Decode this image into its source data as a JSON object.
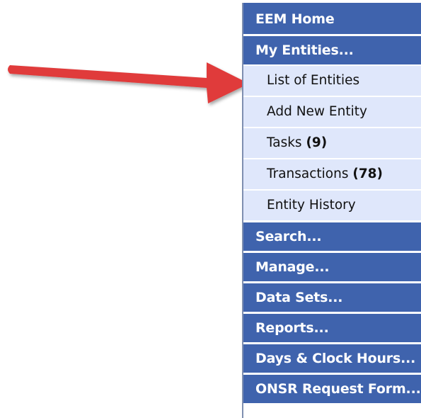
{
  "menu": {
    "items": [
      {
        "label": "EEM Home",
        "type": "header"
      },
      {
        "label": "My Entities...",
        "type": "header"
      },
      {
        "label": "List of Entities",
        "type": "sub"
      },
      {
        "label": "Add New Entity",
        "type": "sub"
      },
      {
        "label": "Tasks ",
        "count": "(9)",
        "type": "sub"
      },
      {
        "label": "Transactions ",
        "count": "(78)",
        "type": "sub"
      },
      {
        "label": "Entity History",
        "type": "sub"
      },
      {
        "label": "Search...",
        "type": "header"
      },
      {
        "label": "Manage...",
        "type": "header"
      },
      {
        "label": "Data Sets...",
        "type": "header"
      },
      {
        "label": "Reports...",
        "type": "header"
      },
      {
        "label": "Days & Clock Hours...",
        "type": "header"
      },
      {
        "label": "ONSR Request Form...",
        "type": "header"
      }
    ]
  },
  "annotation": {
    "arrow_color": "#e03a3a",
    "arrow_icon": "red-arrow-pointer"
  },
  "colors": {
    "header_bg": "#3f63ad",
    "sub_bg": "#dfe7fb"
  }
}
